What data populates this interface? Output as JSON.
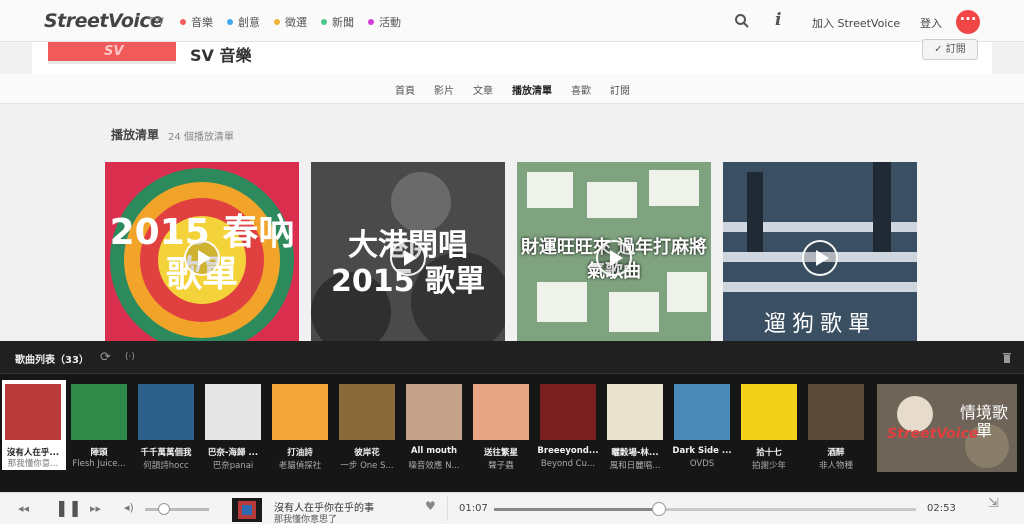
{
  "nav": {
    "logo": "StreetVoice",
    "region": "TW",
    "links": [
      {
        "label": "音樂",
        "color": "#f45a5a"
      },
      {
        "label": "創意",
        "color": "#3ea8f0"
      },
      {
        "label": "徵選",
        "color": "#f2b233"
      },
      {
        "label": "新聞",
        "color": "#4cc78a"
      },
      {
        "label": "活動",
        "color": "#d23ed6"
      }
    ],
    "join": "加入 StreetVoice",
    "login": "登入",
    "more": "···"
  },
  "profile": {
    "banner_text": "SV",
    "name": "SV 音樂",
    "subscribe": "✓ 訂閱"
  },
  "tabs": [
    {
      "label": "首頁",
      "active": false
    },
    {
      "label": "影片",
      "active": false
    },
    {
      "label": "文章",
      "active": false
    },
    {
      "label": "播放清單",
      "active": true
    },
    {
      "label": "喜歡",
      "active": false
    },
    {
      "label": "訂閱",
      "active": false
    }
  ],
  "playlists": {
    "title": "播放清單",
    "count": "24 個播放清單",
    "cards": [
      {
        "title": "2015 春吶歌單",
        "bg": "#d92e4d"
      },
      {
        "title": "大港開唱 2015 歌單",
        "bg": "#555555"
      },
      {
        "title": "財運旺旺來 過年打麻將氣歌曲",
        "bg": "#cfd9cf"
      },
      {
        "title": "遛狗歌單",
        "bg": "#35485a"
      }
    ]
  },
  "songlist": {
    "title": "歌曲列表（33）",
    "tracks": [
      {
        "title": "沒有人在乎...",
        "artist": "那我懂你意...",
        "color": "#b83a3a"
      },
      {
        "title": "陣頭",
        "artist": "Flesh Juice...",
        "color": "#2f8a4a"
      },
      {
        "title": "千千萬萬個我",
        "artist": "何韻詩hocc",
        "color": "#2c5f8a"
      },
      {
        "title": "巴奈-海歸 ...",
        "artist": "巴奈panai",
        "color": "#e6e6e6"
      },
      {
        "title": "打油詩",
        "artist": "老貓偵探社",
        "color": "#f2a63a"
      },
      {
        "title": "彼岸花",
        "artist": "一步 One S...",
        "color": "#8a6a3a"
      },
      {
        "title": "All mouth",
        "artist": "噪音效應 N...",
        "color": "#c4a38a"
      },
      {
        "title": "送往繁星",
        "artist": "聲子蟲",
        "color": "#e7a586"
      },
      {
        "title": "Breeeyond...",
        "artist": "Beyond Cu...",
        "color": "#7a1f1f"
      },
      {
        "title": "曬穀場-林...",
        "artist": "風和日麗唱...",
        "color": "#e9e2cf"
      },
      {
        "title": "Dark Side ...",
        "artist": "OVDS",
        "color": "#4a8ab8"
      },
      {
        "title": "拾十七",
        "artist": "拍謝少年",
        "color": "#f2d11a"
      },
      {
        "title": "酒醉",
        "artist": "非人物種",
        "color": "#5a4a3a"
      }
    ],
    "promo_logo": "StreetVoice",
    "promo_text": "情境歌單"
  },
  "player": {
    "now_title": "沒有人在乎你在乎的事",
    "now_artist": "那我懂你意思了",
    "time_current": "01:07",
    "time_total": "02:53",
    "progress": 0.39,
    "volume": 0.3
  }
}
